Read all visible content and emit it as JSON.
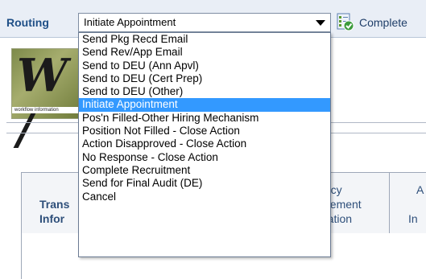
{
  "toolbar": {
    "routing_label": "Routing",
    "selected_value": "Initiate Appointment",
    "complete_label": "Complete",
    "icon": "complete-check-icon"
  },
  "logo": {
    "letters": "W /",
    "caption": "workflow information"
  },
  "dropdown": {
    "selected_index": 5,
    "options": [
      "Send Pkg Recd Email",
      "Send Rev/App Email",
      "Send to DEU (Ann Apvl)",
      "Send to DEU (Cert Prep)",
      "Send to DEU (Other)",
      "Initiate Appointment",
      "Pos'n Filled-Other Hiring Mechanism",
      "Position Not Filled - Close Action",
      "Action Disapproved - Close Action",
      "No Response - Close Action",
      "Complete Recruitment",
      "Send for Final Audit (DE)",
      "Cancel"
    ]
  },
  "panel": {
    "col1_line1": "Trans",
    "col1_line2": "Infor",
    "col2_line1": "ancy",
    "col2_line2": "acement",
    "col2_line3": "mation",
    "col3_line1": "A",
    "col3_line2": "In"
  },
  "colors": {
    "selection": "#3399ff",
    "label": "#1f4f87"
  }
}
